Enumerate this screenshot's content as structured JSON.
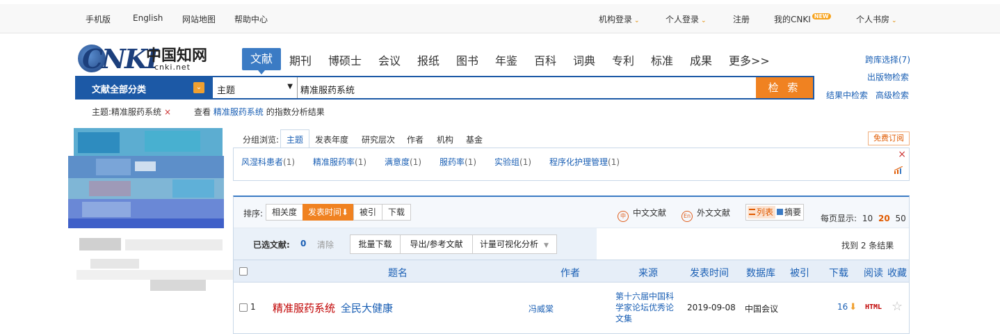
{
  "topbar": {
    "left_links": [
      "手机版",
      "English",
      "网站地图",
      "帮助中心"
    ],
    "inst_login": "机构登录",
    "personal_login": "个人登录",
    "register": "注册",
    "my_cnki": "我的CNKI",
    "new_badge": "NEW",
    "personal_library": "个人书房"
  },
  "logo": {
    "brand": "CNKI",
    "cn_name": "中国知网",
    "url": "cnki.net"
  },
  "nav": {
    "active": "文献",
    "items": [
      "期刊",
      "博硕士",
      "会议",
      "报纸",
      "图书",
      "年鉴",
      "百科",
      "词典",
      "专利",
      "标准",
      "成果",
      "更多>>"
    ]
  },
  "right_links": {
    "cross_db": "跨库选择(7)",
    "publication_search": "出版物检索",
    "search_in_results": "结果中检索",
    "advanced_search": "高级检索"
  },
  "search": {
    "category": "文献全部分类",
    "field": "主题",
    "query": "精准服药系统",
    "button": "检 索"
  },
  "crumb": {
    "condition": "主题:精准服药系统",
    "remove": "×"
  },
  "index_link": {
    "prefix": "查看",
    "keyword": "精准服药系统",
    "suffix": "的指数分析结果"
  },
  "group": {
    "label": "分组浏览:",
    "tabs": [
      "主题",
      "发表年度",
      "研究层次",
      "作者",
      "机构",
      "基金"
    ],
    "active_tab": "主题",
    "subscribe": "免费订阅",
    "items": [
      {
        "name": "风湿科患者",
        "count": "(1)"
      },
      {
        "name": "精准服药率",
        "count": "(1)"
      },
      {
        "name": "满意度",
        "count": "(1)"
      },
      {
        "name": "服药率",
        "count": "(1)"
      },
      {
        "name": "实验组",
        "count": "(1)"
      },
      {
        "name": "程序化护理管理",
        "count": "(1)"
      }
    ],
    "close": "×"
  },
  "sort": {
    "label": "排序:",
    "options": [
      "相关度",
      "发表时间",
      "被引",
      "下载"
    ],
    "active": "发表时间",
    "cn_docs": "中文文献",
    "foreign_docs": "外文文献",
    "view_list": "列表",
    "view_abstract": "摘要",
    "per_page_label": "每页显示:",
    "per_page": [
      "10",
      "20",
      "50"
    ],
    "per_page_current": "20"
  },
  "selection": {
    "selected_label": "已选文献:",
    "selected_count": "0",
    "clear": "清除",
    "bulk_download": "批量下载",
    "export": "导出/参考文献",
    "viz": "计量可视化分析",
    "found": "找到 2 条结果"
  },
  "table": {
    "headers": [
      "题名",
      "作者",
      "来源",
      "发表时间",
      "数据库",
      "被引",
      "下载",
      "阅读",
      "收藏"
    ],
    "rows": [
      {
        "index": "1",
        "title_highlight": "精准服药系统",
        "title_rest": "全民大健康",
        "author": "冯威棠",
        "source_lines": [
          "第十六届中国科",
          "学家论坛优秀论",
          "文集"
        ],
        "date": "2019-09-08",
        "database": "中国会议",
        "cited": "",
        "downloads": "16",
        "read": "HTML"
      }
    ]
  },
  "colors": {
    "primary_blue": "#1c59a6",
    "nav_blue": "#3b7bc4",
    "accent_orange": "#f08221",
    "link_blue": "#1a5fb4",
    "highlight_red": "#c00000"
  }
}
